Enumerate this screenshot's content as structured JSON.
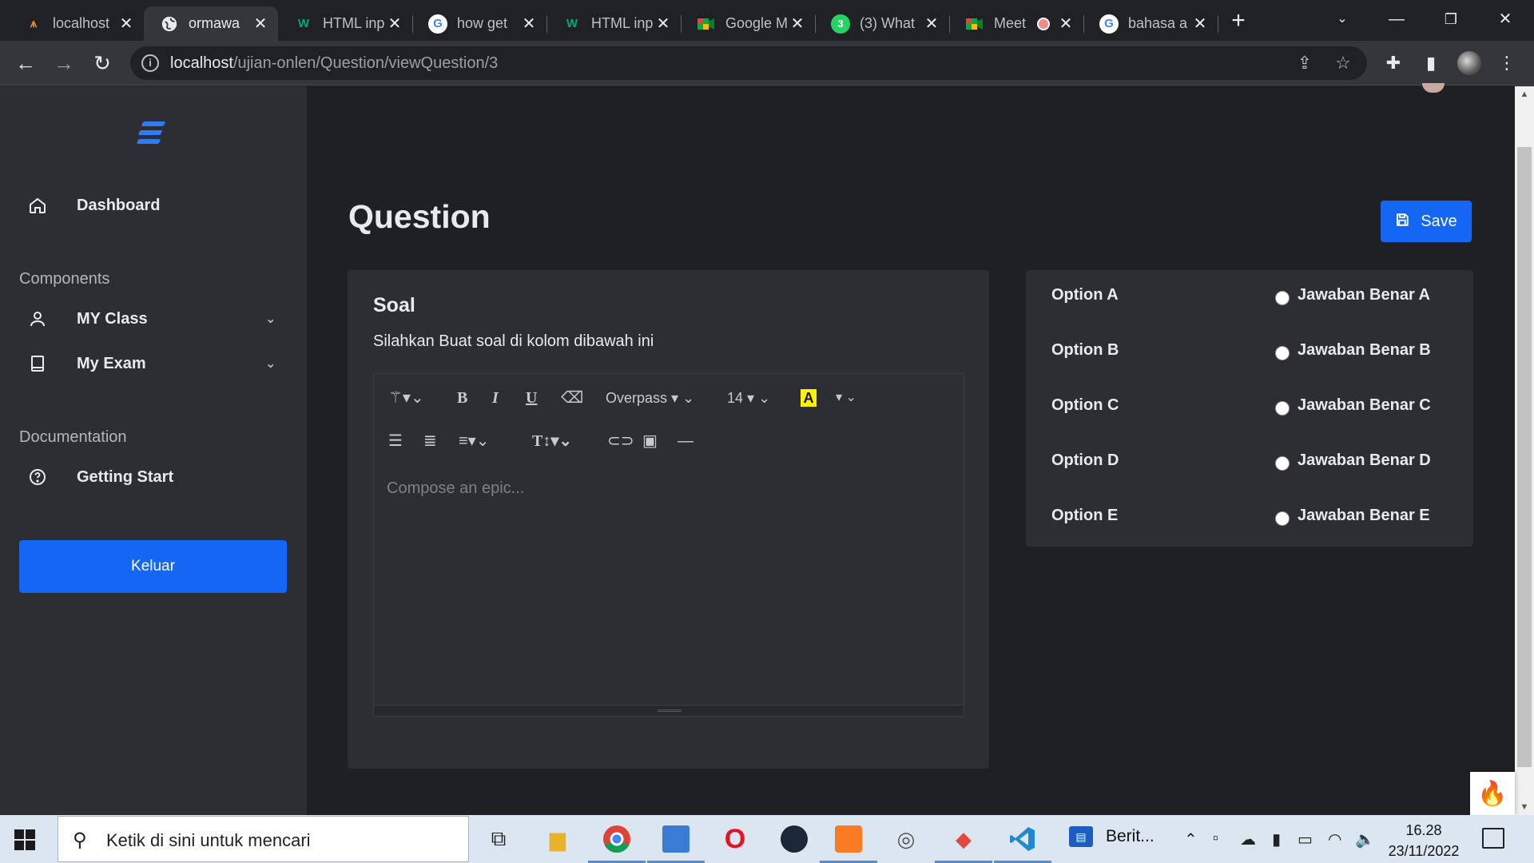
{
  "browser": {
    "tabs": [
      {
        "title": "localhost",
        "favicon": "xampp-icon",
        "active": false
      },
      {
        "title": "ormawa",
        "favicon": "globe-icon",
        "active": true
      },
      {
        "title": "HTML inp",
        "favicon": "w3schools-icon",
        "active": false
      },
      {
        "title": "how get",
        "favicon": "google-icon",
        "active": false
      },
      {
        "title": "HTML inp",
        "favicon": "w3schools-icon",
        "active": false
      },
      {
        "title": "Google M",
        "favicon": "google-meet-icon",
        "active": false
      },
      {
        "title": "(3) What",
        "favicon": "whatsapp-icon",
        "active": false
      },
      {
        "title": "Meet",
        "favicon": "google-meet-icon",
        "active": false
      },
      {
        "title": "bahasa a",
        "favicon": "google-icon",
        "active": false
      }
    ],
    "url_host": "localhost",
    "url_path": "/ujian-onlen/Question/viewQuestion/3"
  },
  "sidebar": {
    "nav": {
      "dashboard": "Dashboard",
      "components_label": "Components",
      "my_class": "MY Class",
      "my_exam": "My Exam",
      "documentation_label": "Documentation",
      "getting_start": "Getting Start"
    },
    "logout_label": "Keluar"
  },
  "main": {
    "page_title": "Question",
    "save_label": "Save",
    "soal": {
      "title": "Soal",
      "description": "Silahkan Buat soal di kolom dibawah ini",
      "editor": {
        "font_name": "Overpass",
        "font_size": "14",
        "highlight_letter": "A",
        "placeholder": "Compose an epic..."
      }
    },
    "options": [
      {
        "label": "Option A",
        "answer": "Jawaban Benar A"
      },
      {
        "label": "Option B",
        "answer": "Jawaban Benar B"
      },
      {
        "label": "Option C",
        "answer": "Jawaban Benar C"
      },
      {
        "label": "Option D",
        "answer": "Jawaban Benar D"
      },
      {
        "label": "Option E",
        "answer": "Jawaban Benar E"
      }
    ]
  },
  "taskbar": {
    "search_placeholder": "Ketik di sini untuk mencari",
    "news_label": "Berit...",
    "time": "16.28",
    "date": "23/11/2022"
  },
  "colors": {
    "accent": "#1466f5",
    "sidebar_bg": "#2c2e33",
    "page_bg": "#1f2023"
  }
}
